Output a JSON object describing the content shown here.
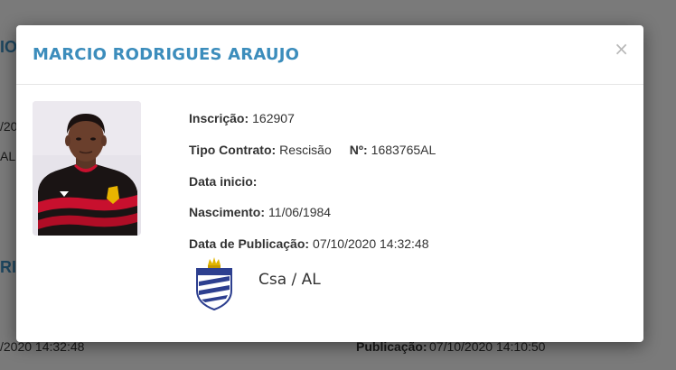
{
  "background": {
    "fragments": [
      "IO",
      "/20",
      "AL",
      "RIC",
      "/2020 14:32:48",
      "Publicação:",
      "07/10/2020 14:10:50"
    ]
  },
  "modal": {
    "title": "MARCIO RODRIGUES ARAUJO",
    "close_label": "×",
    "fields": {
      "inscricao_label": "Inscrição:",
      "inscricao_value": "162907",
      "tipo_contrato_label": "Tipo Contrato:",
      "tipo_contrato_value": "Rescisão",
      "numero_label": "Nº:",
      "numero_value": "1683765AL",
      "data_inicio_label": "Data inicio:",
      "data_inicio_value": "",
      "nascimento_label": "Nascimento:",
      "nascimento_value": "11/06/1984",
      "publicacao_label": "Data de Publicação:",
      "publicacao_value": "07/10/2020 14:32:48"
    },
    "club": {
      "name": "Csa / AL",
      "logo_icon": "csa-crest-icon"
    },
    "photo_icon": "player-photo"
  },
  "colors": {
    "title": "#3c8dbc",
    "overlay": "rgba(0,0,0,0.5)",
    "jersey_red": "#c8102e",
    "crest_blue": "#2d3f8f"
  }
}
